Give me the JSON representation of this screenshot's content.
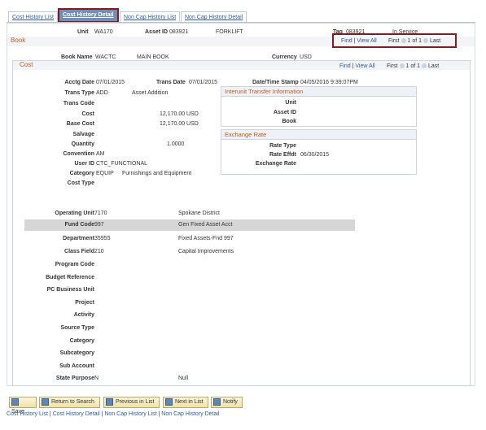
{
  "tabs": [
    {
      "label": "Cost History List"
    },
    {
      "label": "Cost History Detail"
    },
    {
      "label": "Non Cap History List"
    },
    {
      "label": "Non Cap History Detail"
    }
  ],
  "header": {
    "unit_label": "Unit",
    "unit_value": "WA170",
    "asset_id_label": "Asset ID",
    "asset_id_value": "083921",
    "asset_desc": "FORKLIFT",
    "tag_label": "Tag",
    "tag_value": "083921",
    "status": "In Service"
  },
  "book_section": {
    "title": "Book",
    "find": "Find",
    "view_all": "View All",
    "first": "First",
    "count": "1 of 1",
    "last": "Last",
    "book_name_label": "Book Name",
    "book_name_value": "WACTC",
    "book_desc": "MAIN BOOK",
    "currency_label": "Currency",
    "currency_value": "USD"
  },
  "cost_section": {
    "title": "Cost",
    "find": "Find",
    "view_all": "View All",
    "first": "First",
    "count": "1 of 1",
    "last": "Last",
    "acctg_date_label": "Acctg Date",
    "acctg_date_value": "07/01/2015",
    "trans_date_label": "Trans Date",
    "trans_date_value": "07/01/2015",
    "dts_label": "Date/Time Stamp",
    "dts_value": "04/05/2016  9:39:07PM",
    "trans_type_label": "Trans Type",
    "trans_type_value": "ADD",
    "trans_type_desc": "Asset Addition",
    "trans_code_label": "Trans Code",
    "cost_label": "Cost",
    "cost_value": "12,170.00",
    "cost_ccy": "USD",
    "base_cost_label": "Base Cost",
    "base_cost_value": "12,170.00",
    "base_cost_ccy": "USD",
    "salvage_label": "Salvage",
    "quantity_label": "Quantity",
    "quantity_value": "1.0000",
    "convention_label": "Convention",
    "convention_value": "AM",
    "user_id_label": "User ID",
    "user_id_value": "CTC_FUNCTIONAL",
    "category_label": "Category",
    "category_value": "EQUIP",
    "category_desc": "Furnishings and Equipment",
    "cost_type_label": "Cost Type",
    "interunit_title": "Interunit Transfer Information",
    "iu_unit_label": "Unit",
    "iu_asset_label": "Asset ID",
    "iu_book_label": "Book",
    "exchange_title": "Exchange Rate",
    "rate_type_label": "Rate Type",
    "rate_effdt_label": "Rate Effdt",
    "rate_effdt_value": "06/30/2015",
    "exchange_rate_label": "Exchange Rate"
  },
  "chartfields": [
    {
      "label": "Operating Unit",
      "value": "7170",
      "desc": "Spokane District"
    },
    {
      "label": "Fund Code",
      "value": "997",
      "desc": "Gen Fixed Asset Acct"
    },
    {
      "label": "Department",
      "value": "35955",
      "desc": "Fixed Assets-Fnd 997"
    },
    {
      "label": "Class Field",
      "value": "210",
      "desc": "Capital Improvements"
    },
    {
      "label": "Program Code",
      "value": "",
      "desc": ""
    },
    {
      "label": "Budget Reference",
      "value": "",
      "desc": ""
    },
    {
      "label": "PC Business Unit",
      "value": "",
      "desc": ""
    },
    {
      "label": "Project",
      "value": "",
      "desc": ""
    },
    {
      "label": "Activity",
      "value": "",
      "desc": ""
    },
    {
      "label": "Source Type",
      "value": "",
      "desc": ""
    },
    {
      "label": "Category",
      "value": "",
      "desc": ""
    },
    {
      "label": "Subcategory",
      "value": "",
      "desc": ""
    },
    {
      "label": "Sub Account",
      "value": "",
      "desc": ""
    },
    {
      "label": "State Purpose",
      "value": "N",
      "desc": "Null"
    }
  ],
  "buttons": {
    "save": "Save",
    "return": "Return to Search",
    "previous": "Previous in List",
    "next": "Next in List",
    "notify": "Notify"
  },
  "footer_links": [
    "Cost History List",
    "Cost History Detail",
    "Non Cap History List",
    "Non Cap History Detail"
  ]
}
